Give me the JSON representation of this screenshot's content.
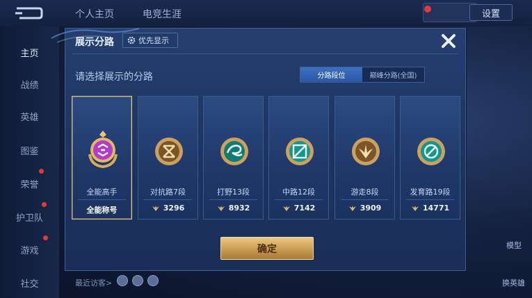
{
  "background": {
    "tabs": [
      "个人主页",
      "电竞生涯"
    ],
    "settings_label": "设置",
    "sidebar": [
      "主页",
      "战绩",
      "英雄",
      "图鉴",
      "荣誉",
      "护卫队",
      "游戏",
      "社交"
    ],
    "right_labels": [
      "模型",
      "换英雄"
    ],
    "recent_visitors_label": "最近访客>"
  },
  "modal": {
    "title": "展示分路",
    "priority_label": "优先显示",
    "prompt": "请选择展示的分路",
    "segments": [
      {
        "label": "分路段位",
        "active": true
      },
      {
        "label": "巅峰分路(全国)",
        "active": false
      }
    ],
    "cards": [
      {
        "name": "全能高手",
        "bottom_text": "全能称号",
        "score": null,
        "selected": true,
        "color": "#b23cc8",
        "icon": "all-round-badge-icon"
      },
      {
        "name": "对抗路7段",
        "bottom_text": null,
        "score": "3296",
        "selected": false,
        "color": "#b08a4c",
        "icon": "clash-lane-badge-icon"
      },
      {
        "name": "打野13段",
        "bottom_text": null,
        "score": "8932",
        "selected": false,
        "color": "#1fa89a",
        "icon": "jungle-badge-icon"
      },
      {
        "name": "中路12段",
        "bottom_text": null,
        "score": "7142",
        "selected": false,
        "color": "#1fa89a",
        "icon": "mid-lane-badge-icon"
      },
      {
        "name": "游走8段",
        "bottom_text": null,
        "score": "3909",
        "selected": false,
        "color": "#b08a4c",
        "icon": "roam-badge-icon"
      },
      {
        "name": "发育路19段",
        "bottom_text": null,
        "score": "14771",
        "selected": false,
        "color": "#1fa89a",
        "icon": "farm-lane-badge-icon"
      }
    ],
    "confirm_label": "确定"
  }
}
